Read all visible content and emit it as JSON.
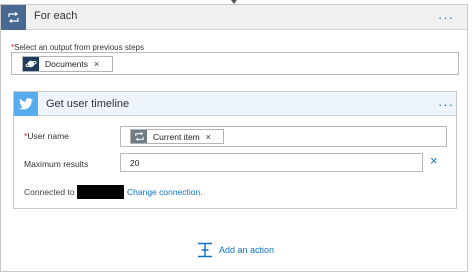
{
  "colors": {
    "foreach_header": "#486991",
    "twitter_brand": "#55acee",
    "link": "#0f73c6",
    "required": "#e81123"
  },
  "foreach": {
    "title": "For each",
    "icon": "loop-icon",
    "menu": "···",
    "select_label": "Select an output from previous steps",
    "required_mark": "*",
    "token": {
      "label": "Documents",
      "icon": "documents-planet-icon",
      "remove": "×"
    }
  },
  "action": {
    "title": "Get user timeline",
    "icon": "twitter-bird-icon",
    "menu": "···",
    "fields": {
      "username": {
        "label": "User name",
        "required_mark": "*",
        "token": {
          "label": "Current item",
          "icon": "loop-icon",
          "remove": "×"
        }
      },
      "max_results": {
        "label": "Maximum results",
        "value": "20",
        "clear": "×"
      }
    },
    "connection": {
      "prefix": "Connected to",
      "change_link": "Change connection."
    }
  },
  "add_action": {
    "label": "Add an action",
    "icon": "add-action-icon"
  }
}
